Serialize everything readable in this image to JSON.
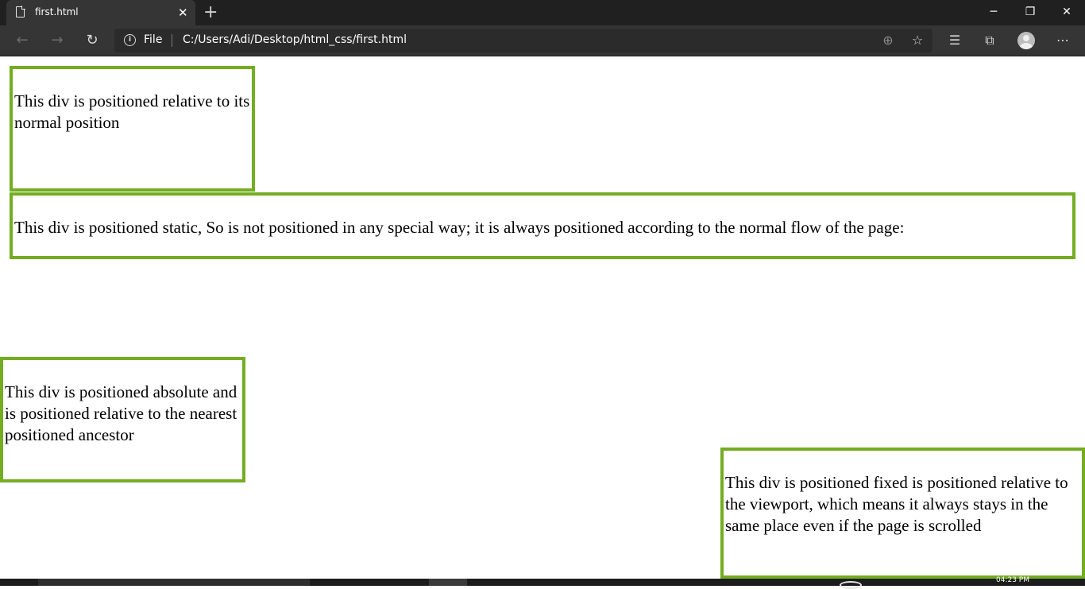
{
  "browser": {
    "tab_title": "first.html",
    "scheme_label": "File",
    "url": "C:/Users/Adi/Desktop/html_css/first.html",
    "clock": "04:23 PM"
  },
  "page": {
    "box_relative": "This div is positioned relative to its normal position",
    "box_static": "This div is positioned static, So is not positioned in any special way; it is always positioned according to the normal flow of the page:",
    "box_absolute": "This div is positioned absolute and is positioned relative to the nearest positioned ancestor",
    "box_fixed": "This div is positioned fixed is positioned relative to the viewport, which means it always stays in the same place even if the page is scrolled"
  },
  "colors": {
    "box_border": "#73ad21",
    "chrome_dark": "#202020",
    "chrome_toolbar": "#353535"
  },
  "icons": [
    "file-icon",
    "close-icon",
    "plus-icon",
    "minimize-icon",
    "restore-icon",
    "back-icon",
    "forward-icon",
    "refresh-icon",
    "info-icon",
    "zoom-icon",
    "add-favorite-icon",
    "favorites-icon",
    "collections-icon",
    "profile-icon",
    "more-icon"
  ]
}
